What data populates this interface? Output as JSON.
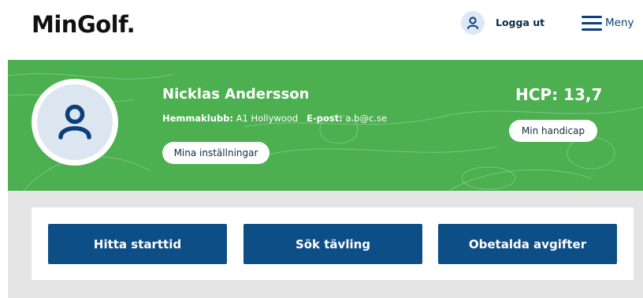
{
  "header": {
    "logo": "MinGolf.",
    "logout_label": "Logga ut",
    "menu_label": "Meny"
  },
  "profile": {
    "name": "Nicklas Andersson",
    "home_club_label": "Hemmaklubb:",
    "home_club_value": "A1 Hollywood",
    "email_label": "E-post:",
    "email_value": "a.b@c.se",
    "settings_button": "Mina inställningar",
    "hcp_text": "HCP: 13,7",
    "handicap_button": "Min handicap"
  },
  "actions": {
    "tee_time": "Hitta starttid",
    "competition": "Sök tävling",
    "fees": "Obetalda avgifter"
  },
  "colors": {
    "hero_green": "#4caf50",
    "primary_blue": "#0d4e86",
    "dark_text": "#0b2b4a"
  }
}
